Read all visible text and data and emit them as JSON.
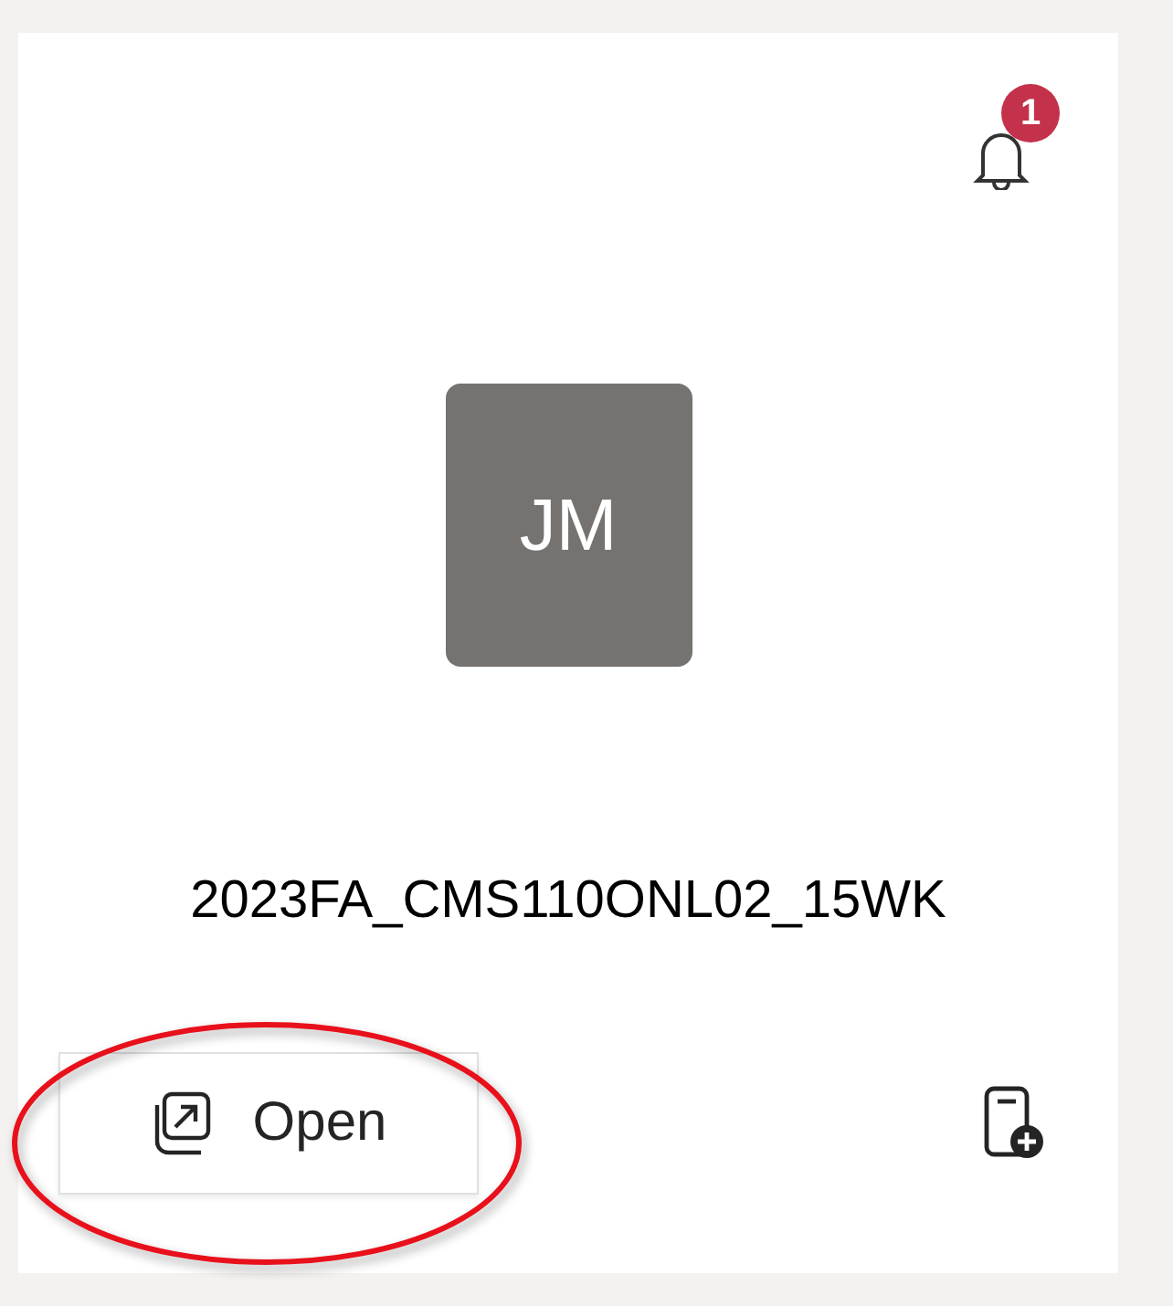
{
  "notifications": {
    "count": "1"
  },
  "avatar": {
    "initials": "JM"
  },
  "team": {
    "name": "2023FA_CMS110ONL02_15WK"
  },
  "actions": {
    "open_button": "Open"
  }
}
